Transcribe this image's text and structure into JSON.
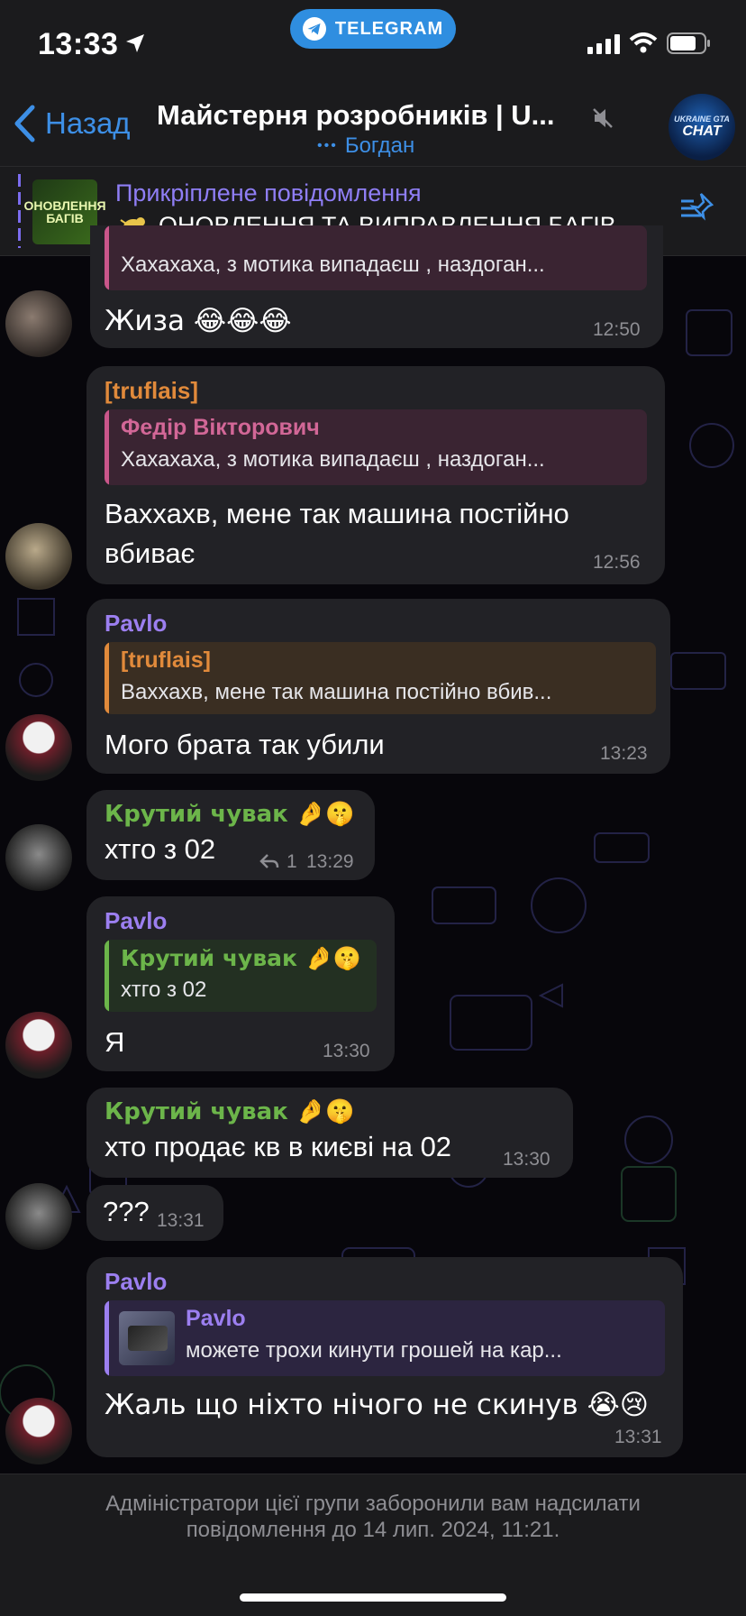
{
  "status_bar": {
    "time": "13:33",
    "app_pill": "TELEGRAM"
  },
  "header": {
    "back_label": "Назад",
    "title": "Майстерня розробників | U...",
    "typing_dots": "•••",
    "typing_user": "Богдан",
    "avatar_line1": "UKRAINE GTA",
    "avatar_line2": "CHAT"
  },
  "pinned": {
    "label": "Прикріплене повідомлення",
    "text": "ОНОВЛЕННЯ ТА ВИПРАВЛЕННЯ БАГІВ...",
    "thumb_text": "ОНОВЛЕННЯ БАГІВ"
  },
  "messages": [
    {
      "reply_text": "Хахахаха, з мотика випадаєш , наздоган...",
      "text": "Жиза 😂😂😂",
      "time": "12:50"
    },
    {
      "sender": "[truflais]",
      "reply_name": "Федір Вікторович",
      "reply_text": "Хахахаха, з мотика випадаєш , наздоган...",
      "text_line1": "Ваххахв, мене так машина постійно",
      "text_line2": "вбиває",
      "time": "12:56"
    },
    {
      "sender": "Pavlo",
      "reply_name": "[truflais]",
      "reply_text": "Ваххахв, мене так машина постійно вбив...",
      "text": "Мого брата так убили",
      "time": "13:23"
    },
    {
      "sender": "Крутий чувак 🤌🤫",
      "text": "хтго з 02",
      "reply_count": "1",
      "time": "13:29"
    },
    {
      "sender": "Pavlo",
      "reply_name": "Крутий чувак 🤌🤫",
      "reply_text": "хтго з 02",
      "text": "Я",
      "time": "13:30"
    },
    {
      "sender": "Крутий чувак 🤌🤫",
      "text": "хто продає кв в києві на 02",
      "time": "13:30"
    },
    {
      "text": "???",
      "time": "13:31"
    },
    {
      "sender": "Pavlo",
      "reply_name": "Pavlo",
      "reply_text": "можете трохи кинути грошей на кар...",
      "text": "Жаль що ніхто нічого не скинув 😭😢",
      "time": "13:31"
    }
  ],
  "footer": {
    "notice": "Адміністратори цієї групи заборонили вам надсилати повідомлення до 14 лип. 2024, 11:21."
  },
  "colors": {
    "accent_blue": "#3d8fe6",
    "pinned_purple": "#8f7ef5",
    "sender_orange": "#e18a3b",
    "sender_purple": "#9c7ff0",
    "sender_green": "#6cb54a",
    "reply_pink": "#c9568a",
    "bubble": "#222226"
  }
}
